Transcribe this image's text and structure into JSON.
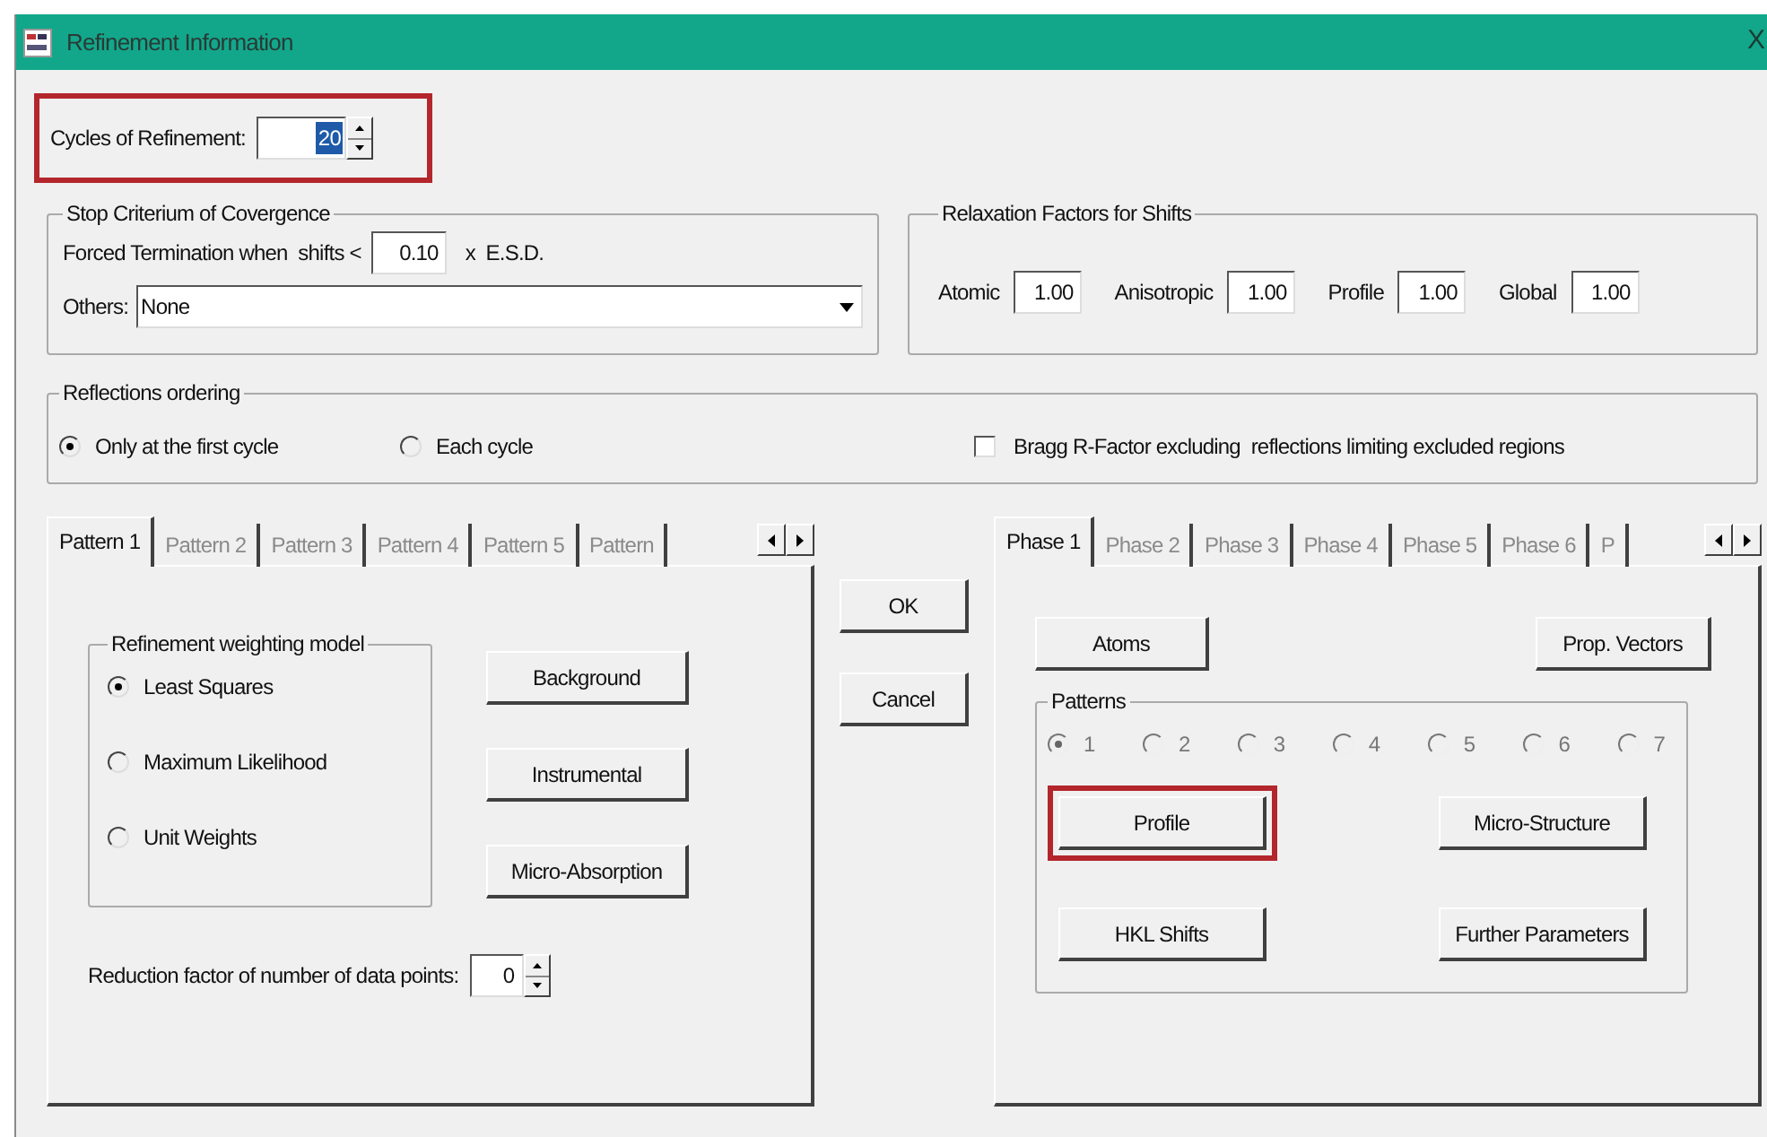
{
  "window": {
    "title": "Refinement Information",
    "close": "X"
  },
  "cycles": {
    "label": "Cycles of Refinement:",
    "value": "20",
    "highlighted": true
  },
  "stop_criterium": {
    "title": "Stop Criterium of Covergence",
    "forced_label": "Forced Termination when  shifts <",
    "forced_value": "0.10",
    "forced_suffix": "x  E.S.D.",
    "others_label": "Others:",
    "others_value": "None"
  },
  "relaxation": {
    "title": "Relaxation Factors for Shifts",
    "fields": [
      {
        "label": "Atomic",
        "value": "1.00"
      },
      {
        "label": "Anisotropic",
        "value": "1.00"
      },
      {
        "label": "Profile",
        "value": "1.00"
      },
      {
        "label": "Global",
        "value": "1.00"
      }
    ]
  },
  "reflections": {
    "title": "Reflections ordering",
    "options": [
      {
        "label": "Only at the first cycle",
        "selected": true
      },
      {
        "label": "Each cycle",
        "selected": false
      }
    ],
    "bragg": {
      "label": "Bragg R-Factor excluding  reflections limiting excluded regions",
      "checked": false
    }
  },
  "pattern_tabs": [
    {
      "label": "Pattern 1",
      "selected": true
    },
    {
      "label": "Pattern 2",
      "selected": false
    },
    {
      "label": "Pattern 3",
      "selected": false
    },
    {
      "label": "Pattern 4",
      "selected": false
    },
    {
      "label": "Pattern 5",
      "selected": false
    },
    {
      "label": "Pattern",
      "selected": false
    }
  ],
  "weighting": {
    "title": "Refinement weighting model",
    "options": [
      {
        "label": "Least Squares",
        "selected": true
      },
      {
        "label": "Maximum Likelihood",
        "selected": false
      },
      {
        "label": "Unit Weights",
        "selected": false
      }
    ]
  },
  "pattern_buttons": [
    "Background",
    "Instrumental",
    "Micro-Absorption"
  ],
  "reduction": {
    "label": "Reduction factor of number of data points:",
    "value": "0"
  },
  "dialog_buttons": [
    "OK",
    "Cancel"
  ],
  "phase_tabs": [
    {
      "label": "Phase 1",
      "selected": true
    },
    {
      "label": "Phase 2",
      "selected": false
    },
    {
      "label": "Phase 3",
      "selected": false
    },
    {
      "label": "Phase 4",
      "selected": false
    },
    {
      "label": "Phase 5",
      "selected": false
    },
    {
      "label": "Phase 6",
      "selected": false
    },
    {
      "label": "P",
      "selected": false
    }
  ],
  "phase_buttons": [
    "Atoms",
    "Prop. Vectors"
  ],
  "patterns": {
    "title": "Patterns",
    "options": [
      {
        "label": "1",
        "selected": true
      },
      {
        "label": "2",
        "selected": false
      },
      {
        "label": "3",
        "selected": false
      },
      {
        "label": "4",
        "selected": false
      },
      {
        "label": "5",
        "selected": false
      },
      {
        "label": "6",
        "selected": false
      },
      {
        "label": "7",
        "selected": false
      }
    ]
  },
  "pattern_phase_buttons": [
    {
      "label": "Profile",
      "highlighted": true
    },
    {
      "label": "Micro-Structure",
      "highlighted": false
    },
    {
      "label": "HKL Shifts",
      "highlighted": false
    },
    {
      "label": "Further Parameters",
      "highlighted": false
    }
  ]
}
